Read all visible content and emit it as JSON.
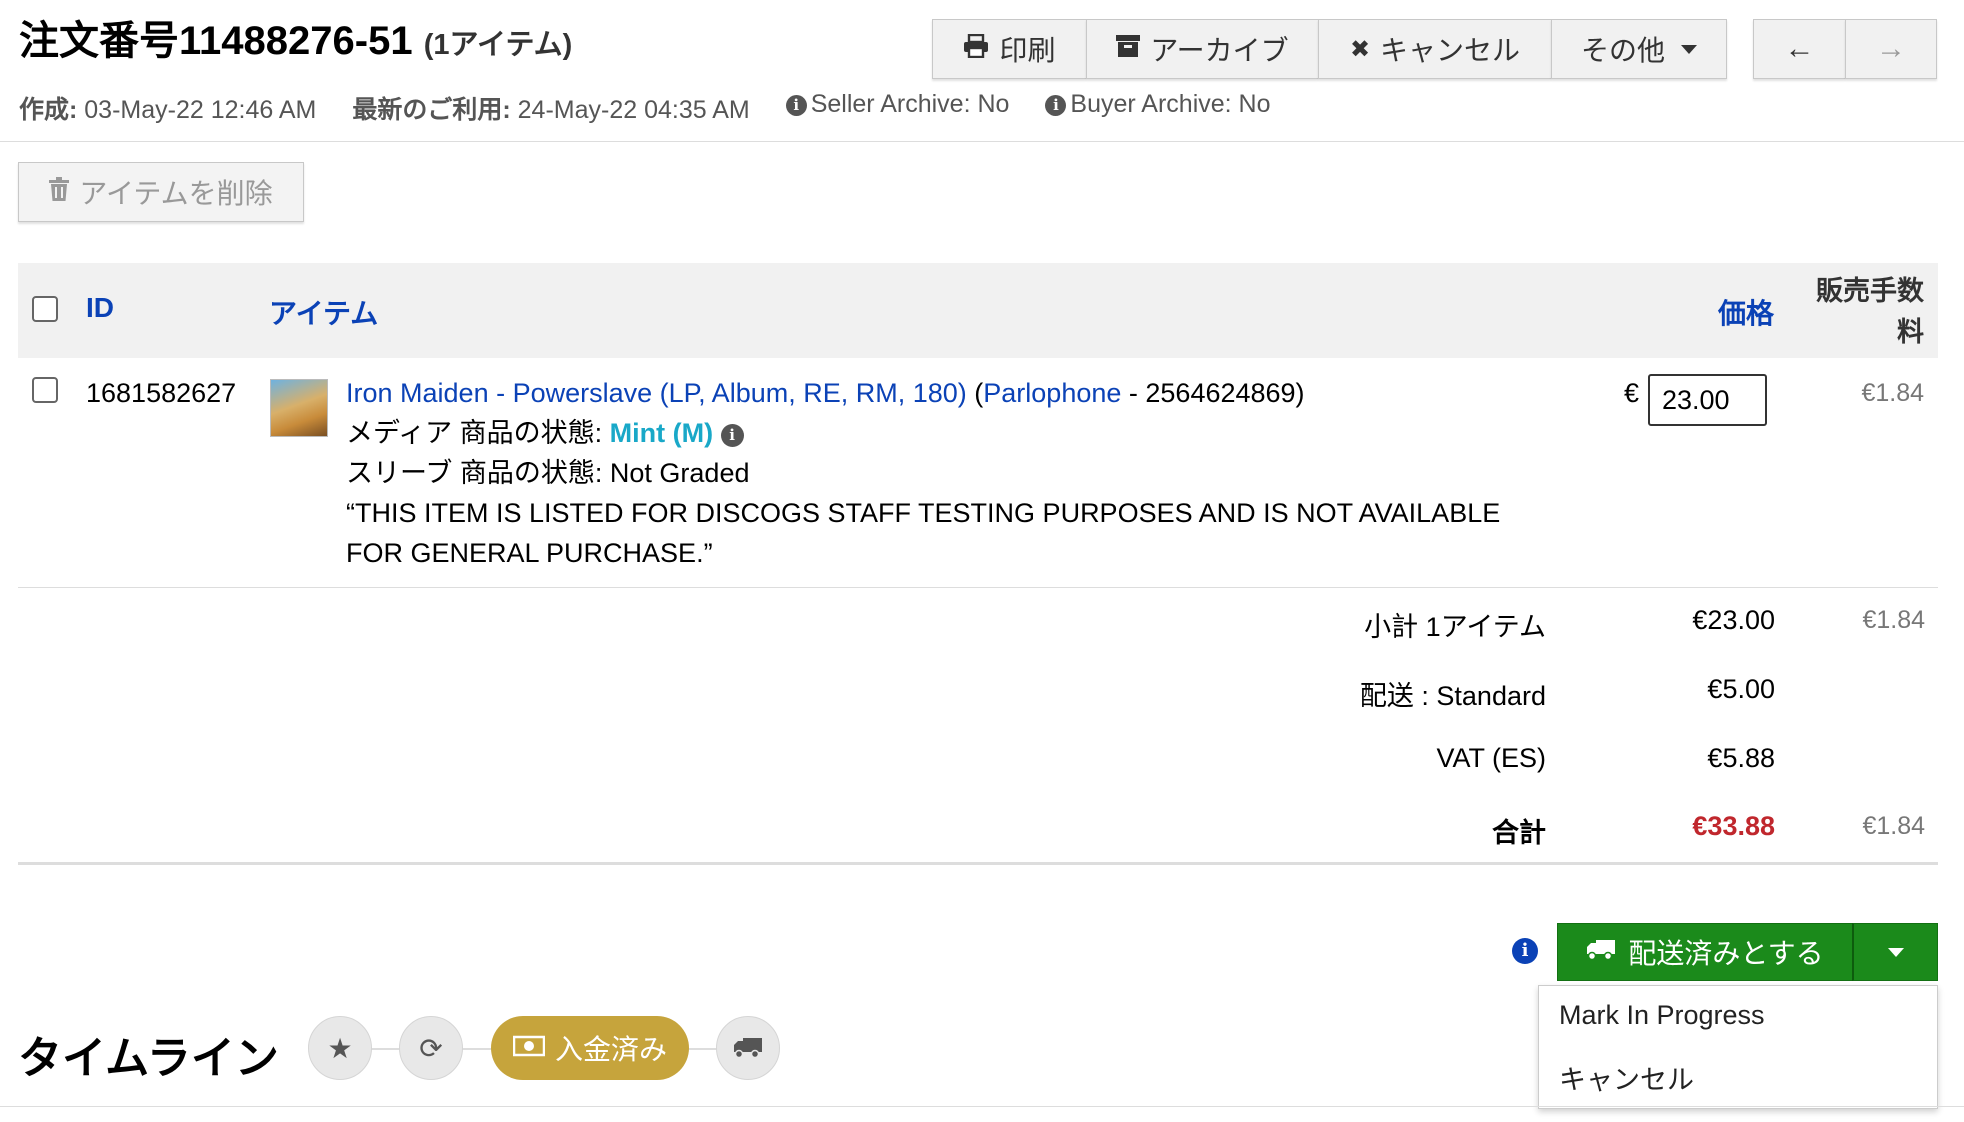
{
  "header": {
    "title": "注文番号11488276-51",
    "item_count": "(1アイテム)",
    "created_label": "作成:",
    "created_value": "03-May-22 12:46 AM",
    "last_used_label": "最新のご利用:",
    "last_used_value": "24-May-22 04:35 AM",
    "seller_archive": "Seller Archive: No",
    "buyer_archive": "Buyer Archive: No"
  },
  "toolbar": {
    "print_label": "印刷",
    "archive_label": "アーカイブ",
    "cancel_label": "キャンセル",
    "more_label": "その他",
    "prev_arrow": "←",
    "next_arrow": "→"
  },
  "delete_items_label": "アイテムを削除",
  "table": {
    "headers": {
      "id": "ID",
      "item": "アイテム",
      "price": "価格",
      "fee_line1": "販売手数",
      "fee_line2": "料"
    },
    "row": {
      "id": "1681582627",
      "title_link": "Iron Maiden - Powerslave (LP, Album, RE, RM, 180)",
      "label_open": "(",
      "label_link": "Parlophone",
      "catalog": " - 2564624869)",
      "media_label": "メディア 商品の状態:",
      "media_value": "Mint (M)",
      "sleeve_label": "スリーブ 商品の状態:",
      "sleeve_value": "Not Graded",
      "comment_line1": "“THIS ITEM IS LISTED FOR DISCOGS STAFF TESTING PURPOSES AND IS NOT AVAILABLE",
      "comment_line2": "FOR GENERAL PURCHASE.”",
      "currency": "€",
      "price_value": "23.00",
      "fee": "€1.84"
    }
  },
  "summary": {
    "subtotal_label": "小計 1アイテム",
    "subtotal_value": "€23.00",
    "subtotal_fee": "€1.84",
    "shipping_label": "配送 : Standard",
    "shipping_value": "€5.00",
    "vat_label": "VAT (ES)",
    "vat_value": "€5.88",
    "total_label": "合計",
    "total_value": "€33.88",
    "total_fee": "€1.84",
    "total_color": "#c0272d"
  },
  "actions": {
    "mark_shipped_label": "配送済みとする",
    "dropdown_items": [
      "Mark In Progress",
      "キャンセル"
    ],
    "accent_green": "#1b8a1b"
  },
  "timeline": {
    "title": "タイムライン",
    "paid_label": "入金済み",
    "paid_color": "#c6a43c"
  }
}
